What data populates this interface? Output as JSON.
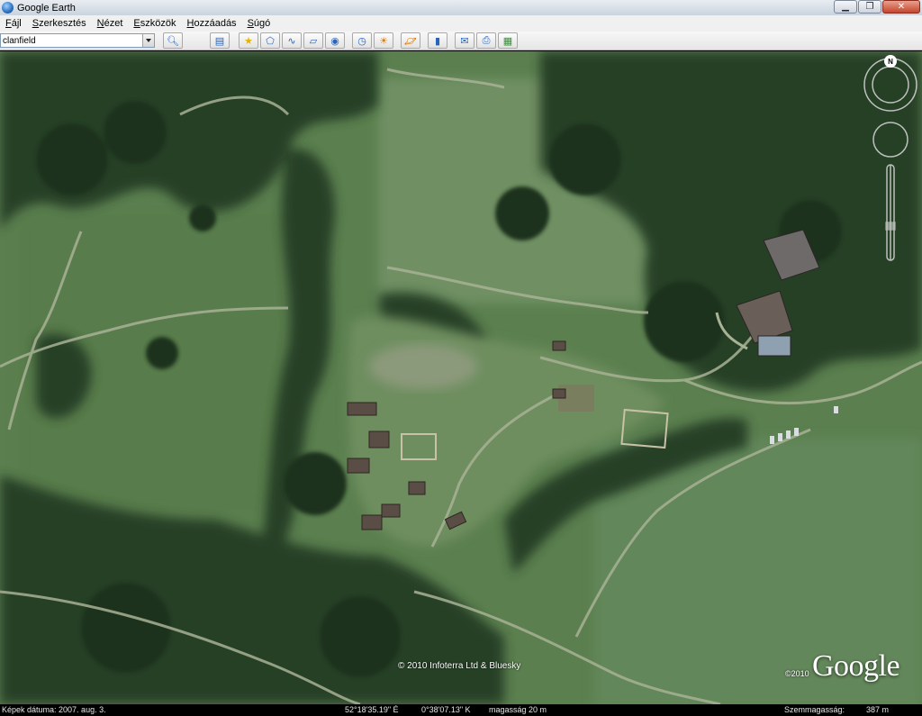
{
  "window": {
    "title": "Google Earth",
    "minimize_glyph": "▁",
    "restore_glyph": "❐",
    "close_glyph": "✕"
  },
  "menu": [
    {
      "label": "Fájl",
      "hotkey": "F",
      "rest": "ájl"
    },
    {
      "label": "Szerkesztés",
      "hotkey": "S",
      "rest": "zerkesztés"
    },
    {
      "label": "Nézet",
      "hotkey": "N",
      "rest": "ézet"
    },
    {
      "label": "Eszközök",
      "hotkey": "E",
      "rest": "szközök"
    },
    {
      "label": "Hozzáadás",
      "hotkey": "H",
      "rest": "ozzáadás"
    },
    {
      "label": "Súgó",
      "hotkey": "S",
      "rest": "úgó"
    }
  ],
  "search": {
    "value": "clanfield"
  },
  "toolbar_icons": [
    "search-icon",
    "sidebar-toggle-icon",
    "placemark-icon",
    "polygon-icon",
    "path-icon",
    "image-overlay-icon",
    "record-tour-icon",
    "historical-imagery-icon",
    "sunlight-icon",
    "planets-icon",
    "ruler-icon",
    "email-icon",
    "print-icon",
    "view-in-maps-icon"
  ],
  "map": {
    "copyright": "© 2010 Infoterra Ltd & Bluesky",
    "google_year": "©2010",
    "google_logo": "Google",
    "compass_label": "N"
  },
  "status": {
    "imagery_date_label": "Képek dátuma: 2007. aug. 3.",
    "latitude": "52°18'35.19\" É",
    "longitude": "0°38'07.13\" K",
    "elevation": "magasság  20 m",
    "eye_alt_label": "Szemmagasság:",
    "eye_alt_value": "387 m"
  },
  "colors": {
    "grass": "#5b7f4f",
    "forest": "#253f27",
    "path": "#a8b295",
    "building": "#5a4d46"
  }
}
